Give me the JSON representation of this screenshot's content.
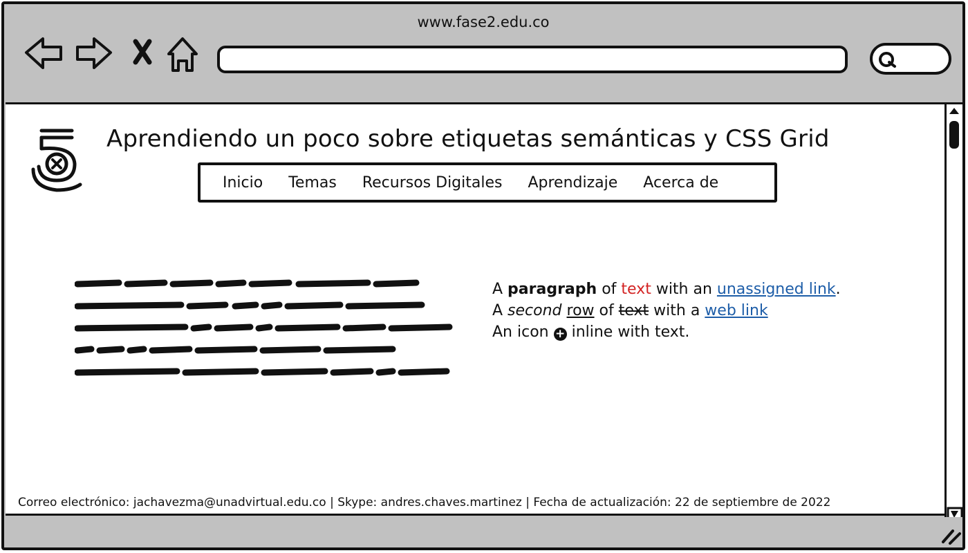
{
  "browser": {
    "url_title": "www.fase2.edu.co",
    "address_value": "",
    "icons": [
      "back-arrow-icon",
      "forward-arrow-icon",
      "close-x-icon",
      "home-icon",
      "search-icon",
      "resize-grip-icon"
    ]
  },
  "page": {
    "logo": "html5-logo",
    "title": "Aprendiendo un poco sobre etiquetas semánticas y CSS Grid",
    "menu": [
      "Inicio",
      "Temas",
      "Recursos Digitales",
      "Aprendizaje",
      "Acerca de"
    ],
    "paragraph": {
      "line1": {
        "a": "A ",
        "b": "paragraph",
        "c": " of ",
        "d": "text",
        "e": " with an ",
        "f": "unassigned link",
        "g": "."
      },
      "line2": {
        "a": "A ",
        "b": "second",
        "c": " ",
        "d": "row",
        "e": " of ",
        "f": "text",
        "g": " with a ",
        "h": "web link"
      },
      "line3": {
        "a": "An icon ",
        "icon": "plus-circle-icon",
        "b": " inline with text."
      }
    },
    "footer": "Correo electrónico: jachavezma@unadvirtual.edu.co | Skype: andres.chaves.martinez | Fecha de actualización: 22 de septiembre de 2022"
  },
  "colors": {
    "chrome": "#c1c1c1",
    "link": "#1d5da8",
    "red_text": "#d32323"
  }
}
